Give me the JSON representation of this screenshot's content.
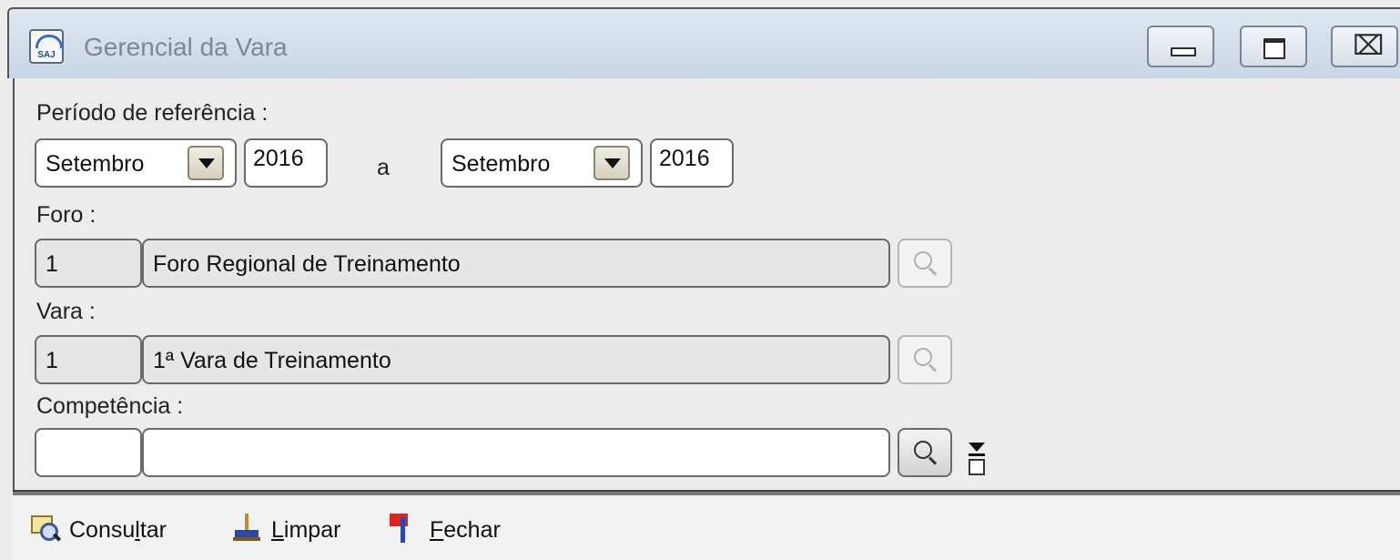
{
  "window": {
    "title": "Gerencial da Vara",
    "app_icon": "saj-app-icon",
    "controls": [
      "minimize-icon",
      "maximize-icon",
      "close-icon"
    ],
    "close_glyph": "⌧"
  },
  "periodo": {
    "label": "Período de referência :",
    "from_month": "Setembro",
    "from_year": "2016",
    "separator": "a",
    "to_month": "Setembro",
    "to_year": "2016"
  },
  "foro": {
    "label": "Foro :",
    "code": "1",
    "name": "Foro Regional de Treinamento"
  },
  "vara": {
    "label": "Vara :",
    "code": "1",
    "name": "1ª Vara de Treinamento"
  },
  "competencia": {
    "label": "Competência :",
    "code": "",
    "name": ""
  },
  "toolbar": {
    "consultar_pre": "Consu",
    "consultar_u": "l",
    "consultar_post": "tar",
    "limpar_u": "L",
    "limpar_post": "impar",
    "fechar_u": "F",
    "fechar_post": "echar"
  },
  "colors": {
    "titlebar": "#dfe8f2",
    "body": "#ececec",
    "disabled_field": "#e6e6e6"
  }
}
